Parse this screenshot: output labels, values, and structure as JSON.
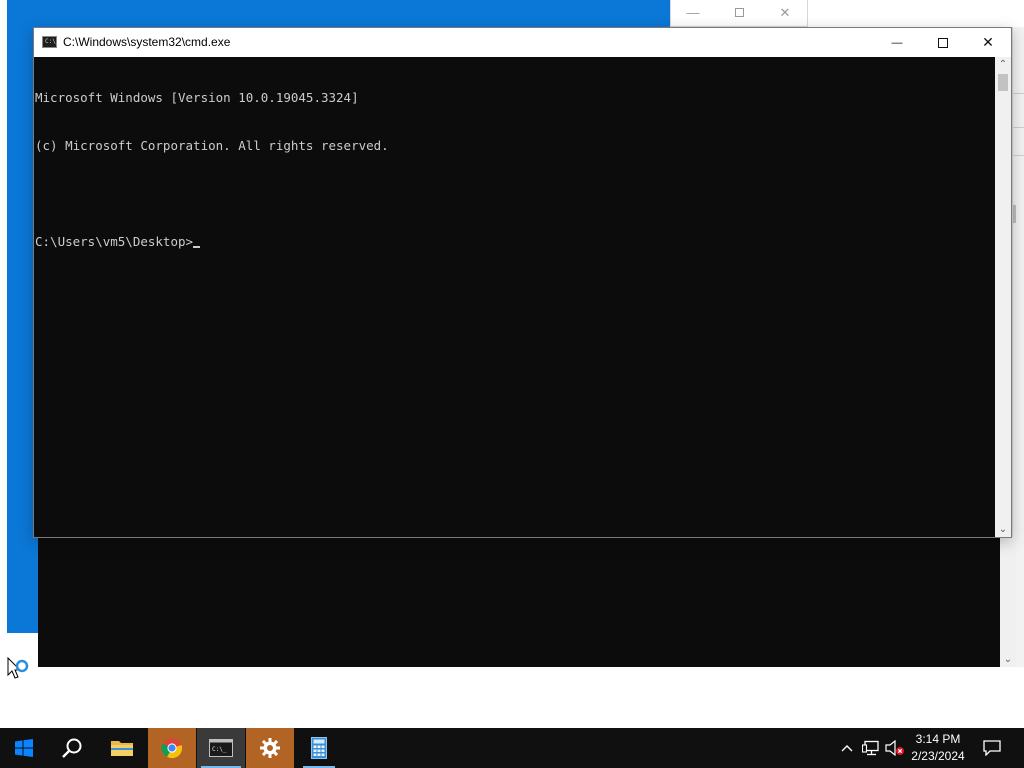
{
  "cmd_window": {
    "title": "C:\\Windows\\system32\\cmd.exe",
    "console_lines": [
      "Microsoft Windows [Version 10.0.19045.3324]",
      "(c) Microsoft Corporation. All rights reserved.",
      "",
      "C:\\Users\\vm5\\Desktop>"
    ],
    "controls": {
      "minimize": "—",
      "close": "✕"
    }
  },
  "background_window": {
    "controls": {
      "minimize": "—",
      "close": "✕"
    }
  },
  "taskbar": {
    "items": [
      {
        "name": "start-button",
        "icon": "windows-logo-icon"
      },
      {
        "name": "search-button",
        "icon": "search-icon"
      },
      {
        "name": "file-explorer",
        "icon": "folder-icon"
      },
      {
        "name": "chrome",
        "icon": "chrome-icon"
      },
      {
        "name": "command-prompt",
        "icon": "terminal-icon"
      },
      {
        "name": "settings",
        "icon": "gear-icon"
      },
      {
        "name": "calculator",
        "icon": "calculator-icon"
      }
    ],
    "clock": {
      "time": "3:14 PM",
      "date": "2/23/2024"
    }
  },
  "colors": {
    "desktop_blue": "#0b78d7",
    "console_bg": "#0c0c0c",
    "console_text": "#cccccc",
    "taskbar": "#101010",
    "taskbar_highlight": "#b26424",
    "active_indicator": "#76b9ed"
  }
}
